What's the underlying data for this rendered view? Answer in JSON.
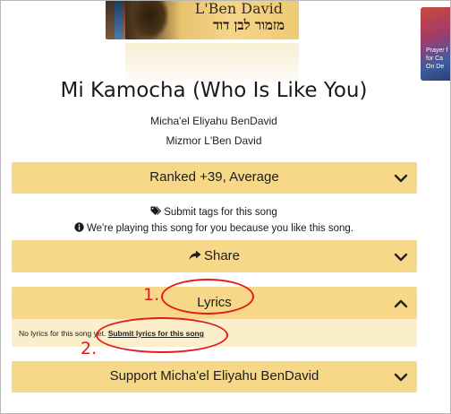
{
  "album_art": {
    "title_text": "L'Ben David",
    "hebrew_text": "מזמור לבן דוד",
    "side_card_text": [
      "Prayer f",
      "for Ca",
      "On De"
    ]
  },
  "song": {
    "title": "Mi Kamocha (Who Is Like You)",
    "artist": "Micha'el Eliyahu BenDavid",
    "album": "Mizmor L'Ben David"
  },
  "ranking_bar": {
    "label": "Ranked +39, Average",
    "icon": "chevron-down-icon"
  },
  "tags_line": {
    "icon": "tags-icon",
    "text": "Submit tags for this song"
  },
  "playing_line": {
    "icon": "info-circle-icon",
    "text": "We're playing this song for you because you like this song."
  },
  "share_bar": {
    "icon": "share-icon",
    "label": "Share",
    "chevron": "chevron-down-icon"
  },
  "lyrics_bar": {
    "label": "Lyrics",
    "chevron": "chevron-up-icon"
  },
  "lyrics_body": {
    "no_lyrics_text": "No lyrics for this song yet.",
    "submit_link": "Submit lyrics for this song"
  },
  "support_bar": {
    "label": "Support Micha'el Eliyahu BenDavid",
    "chevron": "chevron-down-icon"
  },
  "annotations": {
    "step_1": "1.",
    "step_2": "2.",
    "color": "#e31b1b"
  },
  "colors": {
    "bar_background": "#f7d889",
    "panel_background": "#faeecb"
  }
}
